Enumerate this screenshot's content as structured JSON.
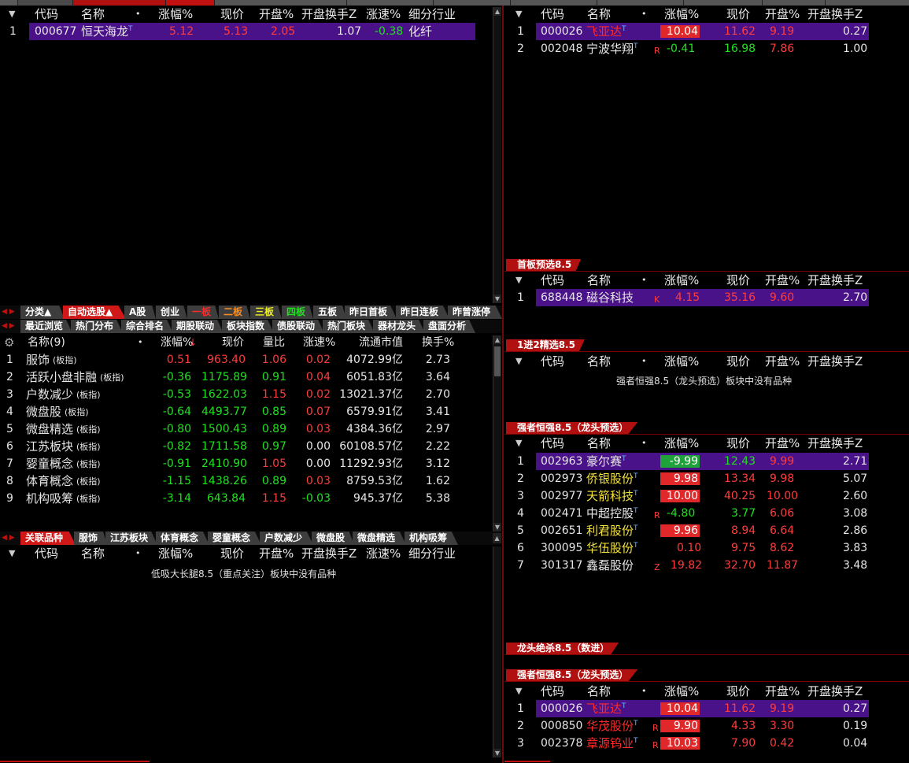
{
  "top_panel_left": {
    "headers": [
      "代码",
      "名称",
      "•",
      "涨幅%",
      "现价",
      "开盘%",
      "开盘换手Z",
      "涨速%",
      "细分行业"
    ],
    "rows": [
      {
        "idx": "1",
        "code": "000677",
        "name": "恒天海龙",
        "sup": "T",
        "chg": "5.12",
        "price": "5.13",
        "open": "2.05",
        "turnover": "1.07",
        "speed": "-0.38",
        "industry": "化纤"
      }
    ]
  },
  "top_panel_right": {
    "headers": [
      "代码",
      "名称",
      "•",
      "涨幅%",
      "现价",
      "开盘%",
      "开盘换手Z"
    ],
    "rows": [
      {
        "idx": "1",
        "code": "000026",
        "name": "飞亚达",
        "sup": "T",
        "tag": "",
        "chg": "10.04",
        "price": "11.62",
        "open": "9.19",
        "turnover": "0.27"
      },
      {
        "idx": "2",
        "code": "002048",
        "name": "宁波华翔",
        "sup": "T",
        "tag": "R",
        "chg": "-0.41",
        "price": "16.98",
        "open": "7.86",
        "turnover": "1.00"
      }
    ]
  },
  "section_shouban": {
    "title": "首板预选8.5",
    "headers": [
      "代码",
      "名称",
      "•",
      "涨幅%",
      "现价",
      "开盘%",
      "开盘换手Z"
    ],
    "rows": [
      {
        "idx": "1",
        "code": "688448",
        "name": "磁谷科技",
        "tag": "K",
        "chg": "4.15",
        "price": "35.16",
        "open": "9.60",
        "turnover": "2.70"
      }
    ]
  },
  "section_1jin2": {
    "title": "1进2精选8.5",
    "headers": [
      "代码",
      "名称",
      "•",
      "涨幅%",
      "现价",
      "开盘%",
      "开盘换手Z"
    ],
    "empty_msg": "强者恒强8.5（龙头预选）板块中没有品种"
  },
  "section_qiangzhe": {
    "title": "强者恒强8.5（龙头预选）",
    "headers": [
      "代码",
      "名称",
      "•",
      "涨幅%",
      "现价",
      "开盘%",
      "开盘换手Z"
    ],
    "rows": [
      {
        "idx": "1",
        "code": "002963",
        "name": "豪尔赛",
        "sup": "T",
        "tag": "",
        "chg": "-9.99",
        "price": "12.43",
        "open": "9.99",
        "turnover": "2.71"
      },
      {
        "idx": "2",
        "code": "002973",
        "name": "侨银股份",
        "sup": "T",
        "tag": "",
        "chg": "9.98",
        "price": "13.34",
        "open": "9.98",
        "turnover": "5.07"
      },
      {
        "idx": "3",
        "code": "002977",
        "name": "天箭科技",
        "sup": "T",
        "tag": "",
        "chg": "10.00",
        "price": "40.25",
        "open": "10.00",
        "turnover": "2.60"
      },
      {
        "idx": "4",
        "code": "002471",
        "name": "中超控股",
        "sup": "T",
        "tag": "R",
        "chg": "-4.80",
        "price": "3.77",
        "open": "6.06",
        "turnover": "3.08"
      },
      {
        "idx": "5",
        "code": "002651",
        "name": "利君股份",
        "sup": "T",
        "tag": "",
        "chg": "9.96",
        "price": "8.94",
        "open": "6.64",
        "turnover": "2.86"
      },
      {
        "idx": "6",
        "code": "300095",
        "name": "华伍股份",
        "sup": "T",
        "tag": "",
        "chg": "0.10",
        "price": "9.75",
        "open": "8.62",
        "turnover": "3.83"
      },
      {
        "idx": "7",
        "code": "301317",
        "name": "鑫磊股份",
        "sup": "",
        "tag": "Z",
        "chg": "19.82",
        "price": "32.70",
        "open": "11.87",
        "turnover": "3.48"
      }
    ]
  },
  "section_longtou": {
    "title": "龙头绝杀8.5（数进）"
  },
  "section_qiangzhe2": {
    "title": "强者恒强8.5（龙头预选）",
    "headers": [
      "代码",
      "名称",
      "•",
      "涨幅%",
      "现价",
      "开盘%",
      "开盘换手Z"
    ],
    "rows": [
      {
        "idx": "1",
        "code": "000026",
        "name": "飞亚达",
        "sup": "T",
        "tag": "",
        "chg": "10.04",
        "price": "11.62",
        "open": "9.19",
        "turnover": "0.27"
      },
      {
        "idx": "2",
        "code": "000850",
        "name": "华茂股份",
        "sup": "T",
        "tag": "R",
        "chg": "9.90",
        "price": "4.33",
        "open": "3.30",
        "turnover": "0.19"
      },
      {
        "idx": "3",
        "code": "002378",
        "name": "章源钨业",
        "sup": "T",
        "tag": "R",
        "chg": "10.03",
        "price": "7.90",
        "open": "0.42",
        "turnover": "0.04"
      }
    ]
  },
  "tabs_row1": [
    "分类▲",
    "自动选股▲",
    "A股",
    "创业",
    "一板",
    "二板",
    "三板",
    "四板",
    "五板",
    "昨日首板",
    "昨日连板",
    "昨曾涨停"
  ],
  "tabs_row2": [
    "最近浏览",
    "热门分布",
    "综合排名",
    "期股联动",
    "板块指数",
    "债股联动",
    "热门板块",
    "器材龙头",
    "盘面分析"
  ],
  "sector_panel": {
    "headers": [
      "名称(9)",
      "•",
      "涨幅%",
      "现价",
      "量比",
      "涨速%",
      "流通市值",
      "换手%"
    ],
    "rows": [
      {
        "idx": "1",
        "name": "服饰",
        "type": "(板指)",
        "chg": "0.51",
        "price": "963.40",
        "vol": "1.06",
        "speed": "0.02",
        "cap": "4072.99亿",
        "turn": "2.73"
      },
      {
        "idx": "2",
        "name": "活跃小盘非融",
        "type": "(板指)",
        "chg": "-0.36",
        "price": "1175.89",
        "vol": "0.91",
        "speed": "0.04",
        "cap": "6051.83亿",
        "turn": "3.64"
      },
      {
        "idx": "3",
        "name": "户数减少",
        "type": "(板指)",
        "chg": "-0.53",
        "price": "1622.03",
        "vol": "1.15",
        "speed": "0.02",
        "cap": "13021.37亿",
        "turn": "2.70"
      },
      {
        "idx": "4",
        "name": "微盘股",
        "type": "(板指)",
        "chg": "-0.64",
        "price": "4493.77",
        "vol": "0.85",
        "speed": "0.07",
        "cap": "6579.91亿",
        "turn": "3.41"
      },
      {
        "idx": "5",
        "name": "微盘精选",
        "type": "(板指)",
        "chg": "-0.80",
        "price": "1500.43",
        "vol": "0.89",
        "speed": "0.03",
        "cap": "4384.36亿",
        "turn": "2.97"
      },
      {
        "idx": "6",
        "name": "江苏板块",
        "type": "(板指)",
        "chg": "-0.82",
        "price": "1711.58",
        "vol": "0.97",
        "speed": "0.00",
        "cap": "60108.57亿",
        "turn": "2.22"
      },
      {
        "idx": "7",
        "name": "婴童概念",
        "type": "(板指)",
        "chg": "-0.91",
        "price": "2410.90",
        "vol": "1.05",
        "speed": "0.00",
        "cap": "11292.93亿",
        "turn": "3.12"
      },
      {
        "idx": "8",
        "name": "体育概念",
        "type": "(板指)",
        "chg": "-1.15",
        "price": "1438.26",
        "vol": "0.89",
        "speed": "0.03",
        "cap": "8759.53亿",
        "turn": "1.62"
      },
      {
        "idx": "9",
        "name": "机构吸筹",
        "type": "(板指)",
        "chg": "-3.14",
        "price": "643.84",
        "vol": "1.15",
        "speed": "-0.03",
        "cap": "945.37亿",
        "turn": "5.38"
      }
    ]
  },
  "tabs_row3": [
    "关联品种",
    "服饰",
    "江苏板块",
    "体育概念",
    "婴童概念",
    "户数减少",
    "微盘股",
    "微盘精选",
    "机构吸筹"
  ],
  "bottom_left": {
    "headers": [
      "代码",
      "名称",
      "•",
      "涨幅%",
      "现价",
      "开盘%",
      "开盘换手Z",
      "涨速%",
      "细分行业"
    ],
    "empty_msg": "低吸大长腿8.5（重点关注）板块中没有品种"
  },
  "colors": {
    "accent_red": "#b01010",
    "selection": "#4a1288",
    "up": "#ff3c3c",
    "down": "#20e020"
  }
}
